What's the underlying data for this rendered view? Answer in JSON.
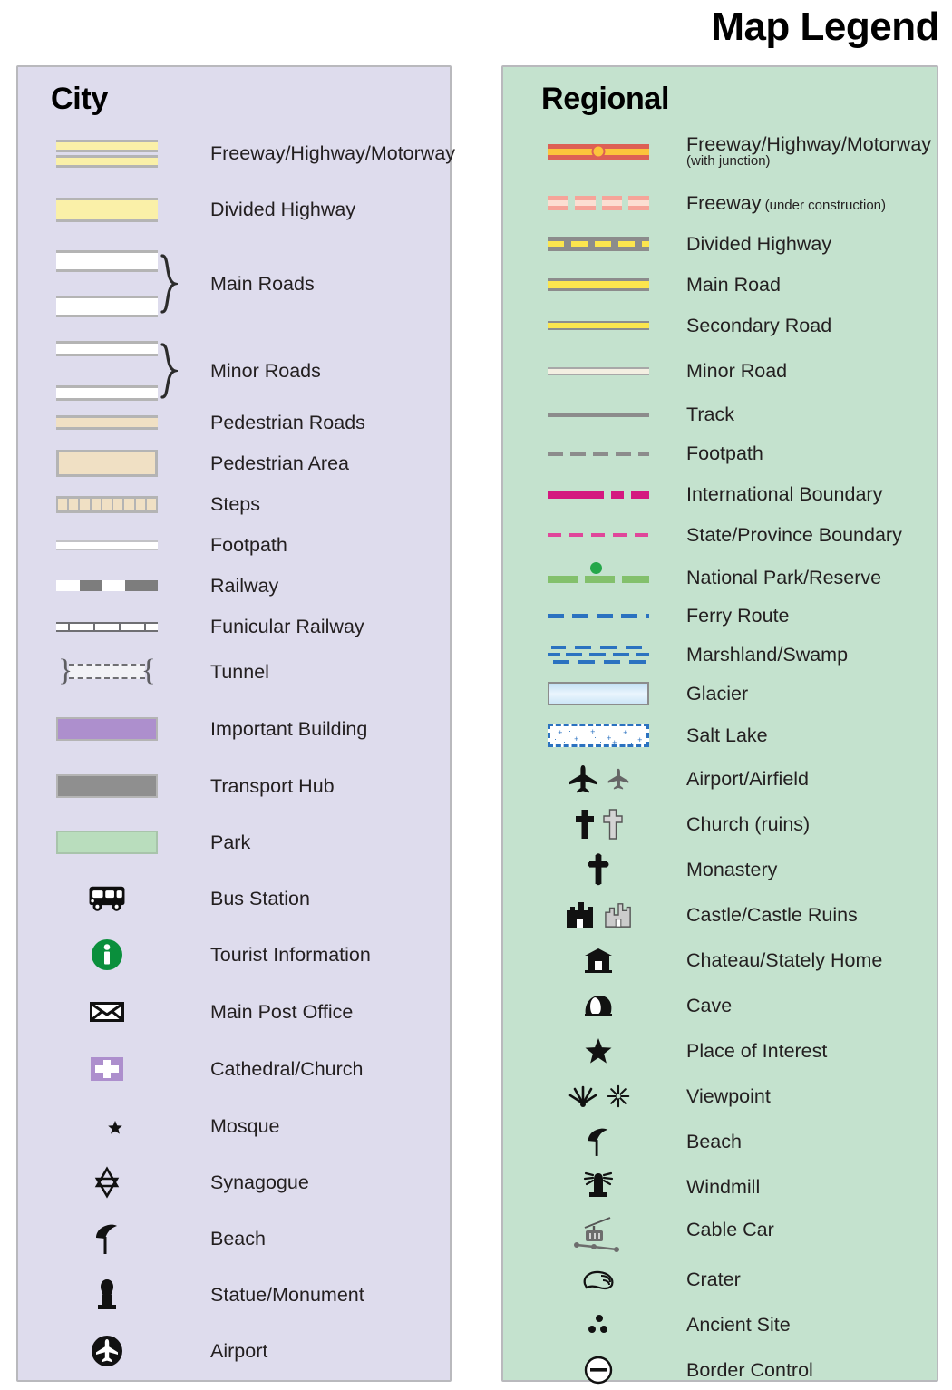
{
  "title": "Map Legend",
  "panels": {
    "city": {
      "heading": "City",
      "background_color": "#dedced",
      "items": [
        {
          "label": "Freeway/Highway/Motorway",
          "symbol": "freeway-double-bar"
        },
        {
          "label": "Divided Highway",
          "symbol": "divided-highway-bar"
        },
        {
          "label": "Main Roads",
          "symbol": "two-white-road-bars-braced"
        },
        {
          "label": "Minor Roads",
          "symbol": "two-thin-white-road-bars-braced"
        },
        {
          "label": "Pedestrian Roads",
          "symbol": "tan-road-bar"
        },
        {
          "label": "Pedestrian Area",
          "symbol": "tan-area-swatch"
        },
        {
          "label": "Steps",
          "symbol": "steps-hatch-bar"
        },
        {
          "label": "Footpath",
          "symbol": "thin-white-line"
        },
        {
          "label": "Railway",
          "symbol": "railway-dash-bar"
        },
        {
          "label": "Funicular Railway",
          "symbol": "funicular-tick-line"
        },
        {
          "label": "Tunnel",
          "symbol": "tunnel-bracketed-dashed"
        },
        {
          "label": "Important Building",
          "symbol": "purple-swatch"
        },
        {
          "label": "Transport Hub",
          "symbol": "gray-swatch"
        },
        {
          "label": "Park",
          "symbol": "green-swatch"
        },
        {
          "label": "Bus Station",
          "symbol": "bus-icon"
        },
        {
          "label": "Tourist Information",
          "symbol": "information-circle-icon"
        },
        {
          "label": "Main Post Office",
          "symbol": "envelope-icon"
        },
        {
          "label": "Cathedral/Church",
          "symbol": "cross-on-purple-icon"
        },
        {
          "label": "Mosque",
          "symbol": "crescent-star-icon"
        },
        {
          "label": "Synagogue",
          "symbol": "star-of-david-icon"
        },
        {
          "label": "Beach",
          "symbol": "parasol-icon"
        },
        {
          "label": "Statue/Monument",
          "symbol": "statue-icon"
        },
        {
          "label": "Airport",
          "symbol": "airplane-circle-icon"
        }
      ]
    },
    "regional": {
      "heading": "Regional",
      "background_color": "#c4e2ce",
      "items": [
        {
          "label": "Freeway/Highway/Motorway",
          "sublabel": "(with junction)",
          "sub_style": "line",
          "symbol": "red-yellow-freeway-with-junction"
        },
        {
          "label": "Freeway",
          "sublabel": "(under construction)",
          "sub_style": "inline",
          "symbol": "dashed-pink-freeway"
        },
        {
          "label": "Divided Highway",
          "symbol": "gray-yellow-dashed-center"
        },
        {
          "label": "Main Road",
          "symbol": "yellow-thick-line"
        },
        {
          "label": "Secondary Road",
          "symbol": "yellow-thin-line"
        },
        {
          "label": "Minor Road",
          "symbol": "cream-thin-line"
        },
        {
          "label": "Track",
          "symbol": "solid-gray-line"
        },
        {
          "label": "Footpath",
          "symbol": "gray-dashed-line"
        },
        {
          "label": "International Boundary",
          "symbol": "magenta-dash-dot-line"
        },
        {
          "label": "State/Province Boundary",
          "symbol": "pink-dashed-line"
        },
        {
          "label": "National Park/Reserve",
          "symbol": "green-dashed-with-dot"
        },
        {
          "label": "Ferry Route",
          "symbol": "blue-dashed-line"
        },
        {
          "label": "Marshland/Swamp",
          "symbol": "marsh-tick-pattern"
        },
        {
          "label": "Glacier",
          "symbol": "glacier-gradient-swatch"
        },
        {
          "label": "Salt Lake",
          "symbol": "salt-lake-dotted-swatch"
        },
        {
          "label": "Airport/Airfield",
          "symbol": "two-airplane-icons"
        },
        {
          "label": "Church (ruins)",
          "symbol": "two-cross-icons"
        },
        {
          "label": "Monastery",
          "symbol": "orthodox-cross-icon"
        },
        {
          "label": "Castle/Castle Ruins",
          "symbol": "two-castle-icons"
        },
        {
          "label": "Chateau/Stately Home",
          "symbol": "chateau-icon"
        },
        {
          "label": "Cave",
          "symbol": "cave-icon"
        },
        {
          "label": "Place of Interest",
          "symbol": "star-icon"
        },
        {
          "label": "Viewpoint",
          "symbol": "two-viewpoint-icons"
        },
        {
          "label": "Beach",
          "symbol": "parasol-icon"
        },
        {
          "label": "Windmill",
          "symbol": "windmill-icon"
        },
        {
          "label": "Cable Car",
          "symbol": "cable-car-icon"
        },
        {
          "label": "Crater",
          "symbol": "crater-icon"
        },
        {
          "label": "Ancient Site",
          "symbol": "three-dots-icon"
        },
        {
          "label": "Border Control",
          "symbol": "minus-circle-icon"
        }
      ]
    }
  },
  "colors": {
    "city_panel": "#dedced",
    "regional_panel": "#c4e2ce",
    "panel_border": "#b9b9bd",
    "road_yellow": "#faf0a8",
    "regional_yellow": "#fbe54e",
    "freeway_red": "#dd6055",
    "freeway_core": "#fcc43c",
    "pedestrian_tan": "#f0e0c4",
    "important_building": "#ad8fcd",
    "transport_hub": "#8f8f8f",
    "park_green": "#b9ddbd",
    "boundary_magenta": "#d4197f",
    "boundary_pink": "#e0469a",
    "national_park_green": "#83c06c",
    "national_park_dot": "#25a74a",
    "ferry_blue": "#2b72c0",
    "tourist_info_green": "#0a8f3c",
    "text": "#231f20"
  }
}
